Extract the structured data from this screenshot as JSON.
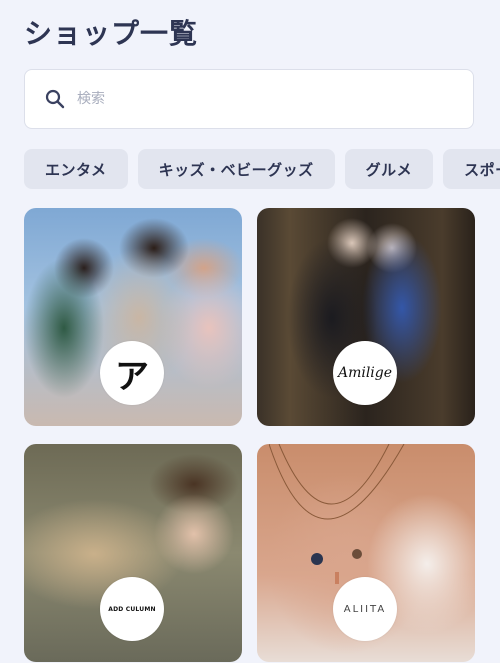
{
  "header": {
    "title": "ショップ一覧"
  },
  "search": {
    "placeholder": "検索"
  },
  "categories": [
    "エンタメ",
    "キッズ・ベビーグッズ",
    "グルメ",
    "スポーツ"
  ],
  "shops": [
    {
      "logo_text": "ア"
    },
    {
      "logo_text": "Amilige"
    },
    {
      "logo_text": "ADD CULUMN"
    },
    {
      "logo_text": "ALIITA"
    }
  ]
}
